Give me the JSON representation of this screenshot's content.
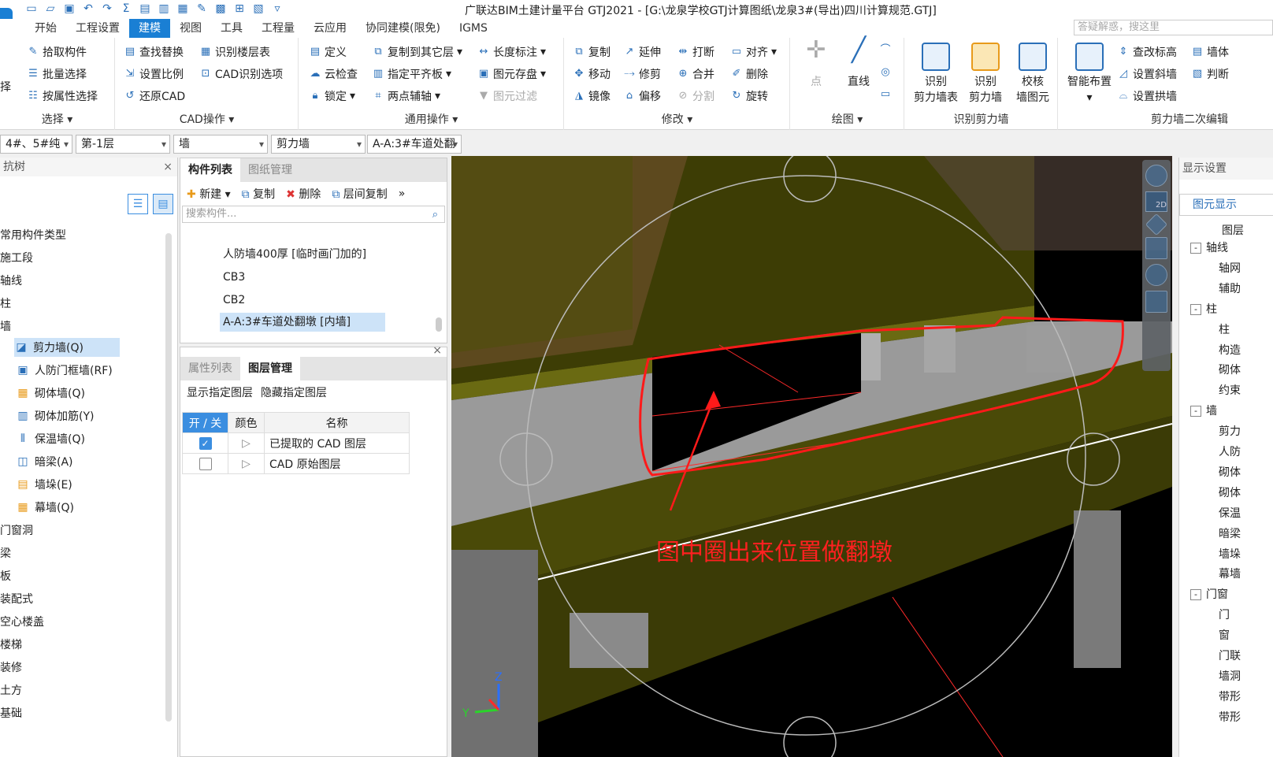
{
  "window": {
    "title": "广联达BIM土建计量平台 GTJ2021 - [G:\\龙泉学校GTJ计算图纸\\龙泉3#(导出)四川计算规范.GTJ]",
    "search_placeholder": "答疑解惑，搜这里"
  },
  "menu": {
    "tabs": [
      "开始",
      "工程设置",
      "建模",
      "视图",
      "工具",
      "工程量",
      "云应用",
      "协同建模(限免)",
      "IGMS"
    ]
  },
  "ribbon": {
    "select_group": {
      "label": "选择",
      "partial_label": "择",
      "pick": "拾取构件",
      "batch": "批量选择",
      "by_attr": "按属性选择"
    },
    "cad_group": {
      "label": "CAD操作",
      "find_replace": "查找替换",
      "identify_floor_table": "识别楼层表",
      "set_scale": "设置比例",
      "cad_options": "CAD识别选项",
      "restore_cad": "还原CAD"
    },
    "common_group": {
      "label": "通用操作",
      "define": "定义",
      "copy_to_floor": "复制到其它层",
      "length_mark": "长度标注",
      "cloud_check": "云检查",
      "align_slab": "指定平齐板",
      "save_elem": "图元存盘",
      "lock": "锁定",
      "two_point_axis": "两点辅轴",
      "elem_filter": "图元过滤"
    },
    "modify_group": {
      "label": "修改",
      "copy": "复制",
      "extend": "延伸",
      "break": "打断",
      "align": "对齐",
      "move": "移动",
      "trim": "修剪",
      "merge": "合并",
      "delete": "删除",
      "mirror": "镜像",
      "offset": "偏移",
      "split": "分割",
      "rotate": "旋转"
    },
    "draw_group": {
      "label": "绘图",
      "point": "点",
      "line": "直线"
    },
    "shearwall_group": {
      "label": "识别剪力墙",
      "identify_table_top": "识别",
      "identify_table_bottom": "剪力墙表",
      "identify_wall_top": "识别",
      "identify_wall_bottom": "剪力墙",
      "check_top": "校核",
      "check_bottom": "墙图元"
    },
    "secondary_group": {
      "label": "剪力墙二次编辑",
      "smart_layout": "智能布置",
      "check_elev": "查改标高",
      "set_slope": "设置斜墙",
      "set_arch": "设置拱墙",
      "wall_body": "墙体",
      "judge": "判断"
    }
  },
  "filters": {
    "building": "4#、5#纯",
    "floor": "第-1层",
    "category": "墙",
    "type": "剪力墙",
    "component": "A-A:3#车道处翻"
  },
  "nav_tree": {
    "title": "抗树",
    "items": [
      "常用构件类型",
      "施工段",
      "轴线",
      "柱",
      "墙",
      "剪力墙(Q)",
      "人防门框墙(RF)",
      "砌体墙(Q)",
      "砌体加筋(Y)",
      "保温墙(Q)",
      "暗梁(A)",
      "墙垛(E)",
      "幕墙(Q)",
      "门窗洞",
      "梁",
      "板",
      "装配式",
      "空心楼盖",
      "楼梯",
      "装修",
      "土方",
      "基础"
    ]
  },
  "component_list": {
    "tabs": [
      "构件列表",
      "图纸管理"
    ],
    "toolbar": {
      "new": "新建",
      "copy": "复制",
      "delete": "删除",
      "floor_copy": "层间复制"
    },
    "search_placeholder": "搜索构件...",
    "items": [
      "人防墙400厚 [临时画门加的]",
      "CB3",
      "CB2",
      "A-A:3#车道处翻墩 [内墙]"
    ]
  },
  "layer_panel": {
    "tabs": [
      "属性列表",
      "图层管理"
    ],
    "actions": {
      "show": "显示指定图层",
      "hide": "隐藏指定图层"
    },
    "columns": [
      "开 / 关",
      "颜色",
      "名称"
    ],
    "rows": [
      {
        "on": true,
        "name": "已提取的 CAD 图层"
      },
      {
        "on": false,
        "name": "CAD 原始图层"
      }
    ]
  },
  "viewport": {
    "annotation": "图中圈出来位置做翻墩",
    "axis_z": "Z",
    "axis_y": "Y",
    "view_level": "2D"
  },
  "display_panel": {
    "title": "显示设置",
    "tab": "图元显示",
    "header": "图层",
    "rows": [
      {
        "expander": "-",
        "label": "轴线"
      },
      {
        "label": "轴网"
      },
      {
        "label": "辅助"
      },
      {
        "expander": "-",
        "label": "柱"
      },
      {
        "label": "柱"
      },
      {
        "label": "构造"
      },
      {
        "label": "砌体"
      },
      {
        "label": "约束"
      },
      {
        "expander": "-",
        "label": "墙"
      },
      {
        "label": "剪力"
      },
      {
        "label": "人防"
      },
      {
        "label": "砌体"
      },
      {
        "label": "砌体"
      },
      {
        "label": "保温"
      },
      {
        "label": "暗梁"
      },
      {
        "label": "墙垛"
      },
      {
        "label": "幕墙"
      },
      {
        "expander": "-",
        "label": "门窗"
      },
      {
        "label": "门"
      },
      {
        "label": "窗"
      },
      {
        "label": "门联"
      },
      {
        "label": "墙洞"
      },
      {
        "label": "带形"
      },
      {
        "label": "带形"
      }
    ]
  },
  "colors": {
    "accent": "#1a7fd4",
    "annotation": "#ff2020",
    "slab": "#5a5a10",
    "wall": "#8c8c8c"
  }
}
